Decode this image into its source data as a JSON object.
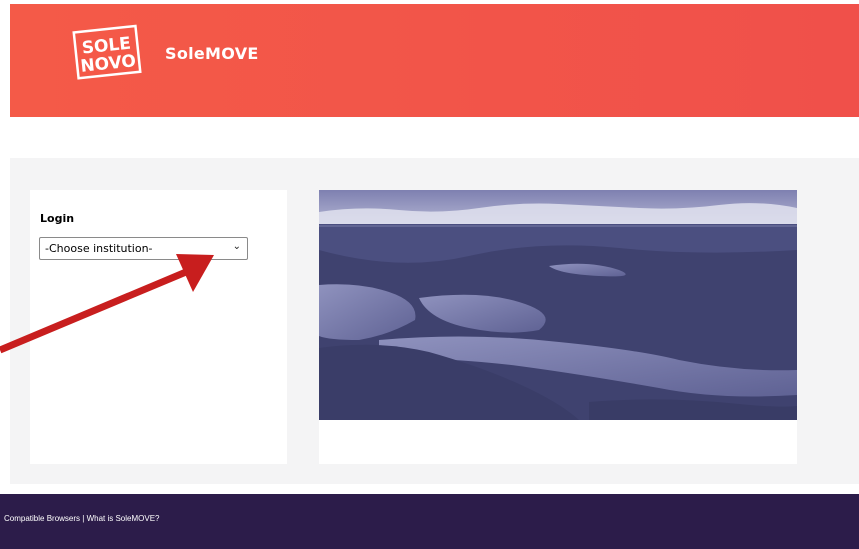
{
  "header": {
    "logo_line1": "SOLE",
    "logo_line2": "NOVO",
    "brand": "SoleMOVE",
    "color": "#f2544a"
  },
  "login": {
    "title": "Login",
    "select_value": "-Choose institution-"
  },
  "photo": {
    "subject": "aerial lake and forest landscape"
  },
  "footer": {
    "link1": "Compatible Browsers",
    "separator": " | ",
    "link2": "What is SoleMOVE?",
    "color": "#2c1c4a"
  },
  "annotation": {
    "arrow_color": "#c81e1e"
  }
}
